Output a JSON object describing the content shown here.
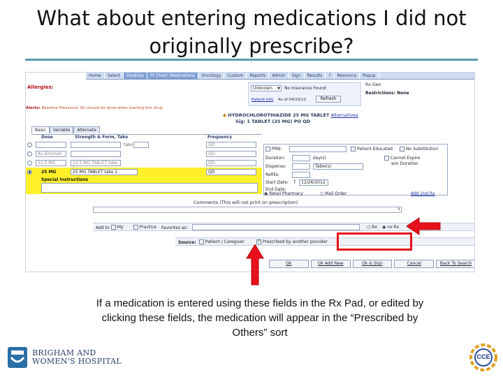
{
  "slide": {
    "title_line1": "What about entering medications I did not",
    "title_line2": "originally prescribe?",
    "caption_line1": "If a medication is entered using these fields in the Rx Pad, or edited by",
    "caption_line2": "clicking these fields, the medication will appear in the “Prescribed by",
    "caption_line3": "Others” sort"
  },
  "logos": {
    "bw_line1": "BRIGHAM AND",
    "bw_line2": "WOMEN'S HOSPITAL",
    "cce_text": "CCE"
  },
  "colors": {
    "title_rule": "#5b9bb0",
    "arrow_red": "#e8101c",
    "highlight_yellow": "#fff02a",
    "menu_active": "#7fa0d6"
  },
  "ui": {
    "menu": [
      {
        "label": "Home"
      },
      {
        "label": "Select"
      },
      {
        "label": "Desktop"
      },
      {
        "label": "Pt Chart: Medications"
      },
      {
        "label": "Oncology"
      },
      {
        "label": "Custom"
      },
      {
        "label": "Reports"
      },
      {
        "label": "Admin"
      },
      {
        "label": "Sign"
      },
      {
        "label": "Results"
      },
      {
        "label": "?"
      },
      {
        "label": "Resource"
      },
      {
        "label": "Popup"
      }
    ],
    "allergies_label": "Allergies:",
    "insurance_select": "Unknown",
    "insurance_text": "No Insurance Found",
    "patient_info_link": "Patient Info",
    "as_of": "As of 04/10/12",
    "refresh_button": "Refresh",
    "rxgen": "Rx-Gen",
    "restrictions": "Restrictions: None",
    "alerts_label": "Alerts:",
    "alerts_text": "Baseline Potassium (K) should be done when starting this drug.",
    "drug_name": "HYDROCHLOROTHIAZIDE 25 MG TABLET",
    "alternatives_link": "Alternatives",
    "sig": "Sig: 1 TABLET (25 MG) PO QD",
    "tabs": [
      "Basic",
      "Variable",
      "Alternate"
    ],
    "grid_headers": {
      "dose": "Dose",
      "strength": "Strength & Form, Take",
      "frequency": "Frequency"
    },
    "rows": [
      {
        "dose": "",
        "strength": "",
        "take": "take",
        "freq": "QD"
      },
      {
        "dose": "As directed",
        "strength": "",
        "take": "",
        "freq": "QD"
      },
      {
        "dose": "12.5 MG",
        "strength": "12.5 MG TABLET take 1",
        "take": "",
        "freq": "QD"
      },
      {
        "dose": "25 MG",
        "strength": "25 MG TABLET take 1",
        "take": "",
        "freq": "QD"
      }
    ],
    "special_instructions": "Special Instructions",
    "prn": "PRN:",
    "patient_educated": "Patient Educated",
    "no_substitution": "No Substitution",
    "duration": "Duration:",
    "duration_unit": "day(s)",
    "cannot_expire": "Cannot Expire",
    "wo_duration": "w/o Duration",
    "dispense": "Dispense:",
    "dispense_unit": "Table(s)",
    "refills": "Refills:",
    "start_date": "Start Date:",
    "start_prefix": "T",
    "start_value": "12/26/2012",
    "end_date": "End Date:",
    "retail_pharmacy": "Retail Pharmacy",
    "mail_order": "Mail Order",
    "add_2nd_rx": "Add 2nd Rx",
    "comments_label": "Comments (This will not print on prescription)",
    "add_to": "Add to",
    "my": "My",
    "practice": "Practice",
    "favorites_as": "Favorites as:",
    "rx": "Rx",
    "no_rx": "no Rx",
    "source_label": "Source:",
    "patient_caregiver": "Patient / Caregiver",
    "prescribed_by_another": "Prescribed by another provider",
    "buttons": [
      "Ok",
      "Ok Add New",
      "Ok & Sign",
      "Cancel",
      "Back To Search"
    ]
  }
}
